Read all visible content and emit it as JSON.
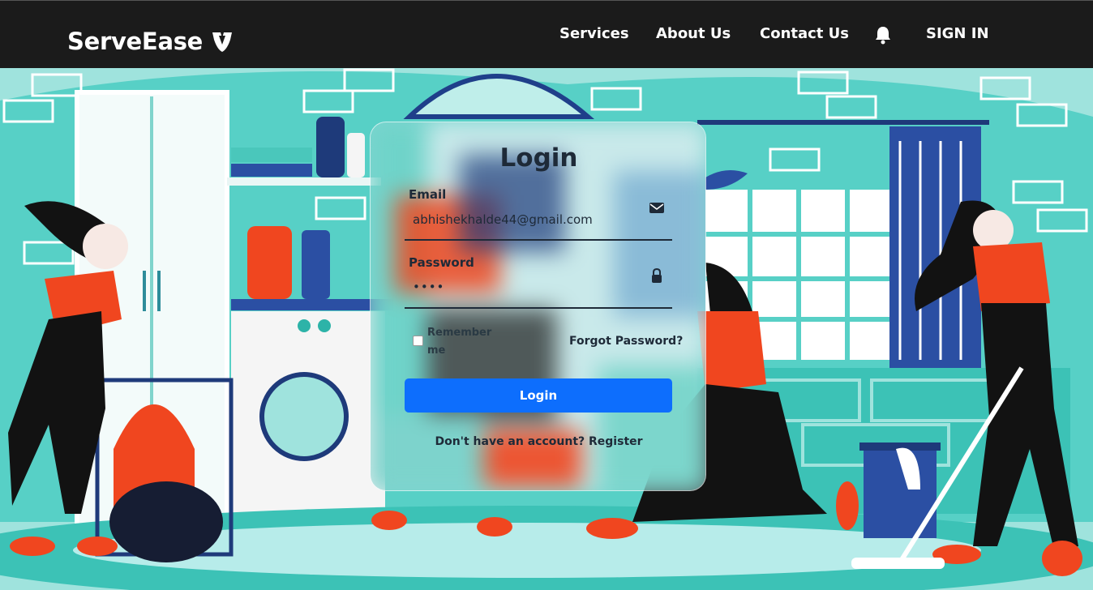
{
  "app": {
    "brand": "ServeEase",
    "brand_icon": "shield-v-icon"
  },
  "nav": {
    "items": [
      {
        "label": "Services"
      },
      {
        "label": "About Us"
      },
      {
        "label": "Contact Us"
      }
    ],
    "notification_icon": "bell-icon",
    "signin_label": "SIGN IN"
  },
  "login": {
    "title": "Login",
    "email_label": "Email",
    "email_value": "abhishekhalde44@gmail.com",
    "email_icon": "envelope-icon",
    "password_label": "Password",
    "password_value": "••••",
    "password_icon": "lock-icon",
    "remember_label": "Remember me",
    "forgot_label": "Forgot Password?",
    "submit_label": "Login",
    "register_text": "Don't have an account? Register"
  },
  "colors": {
    "navbar": "#1b1b1b",
    "primary_button": "#0d6efd",
    "background_teal": "#9fe3dd"
  }
}
